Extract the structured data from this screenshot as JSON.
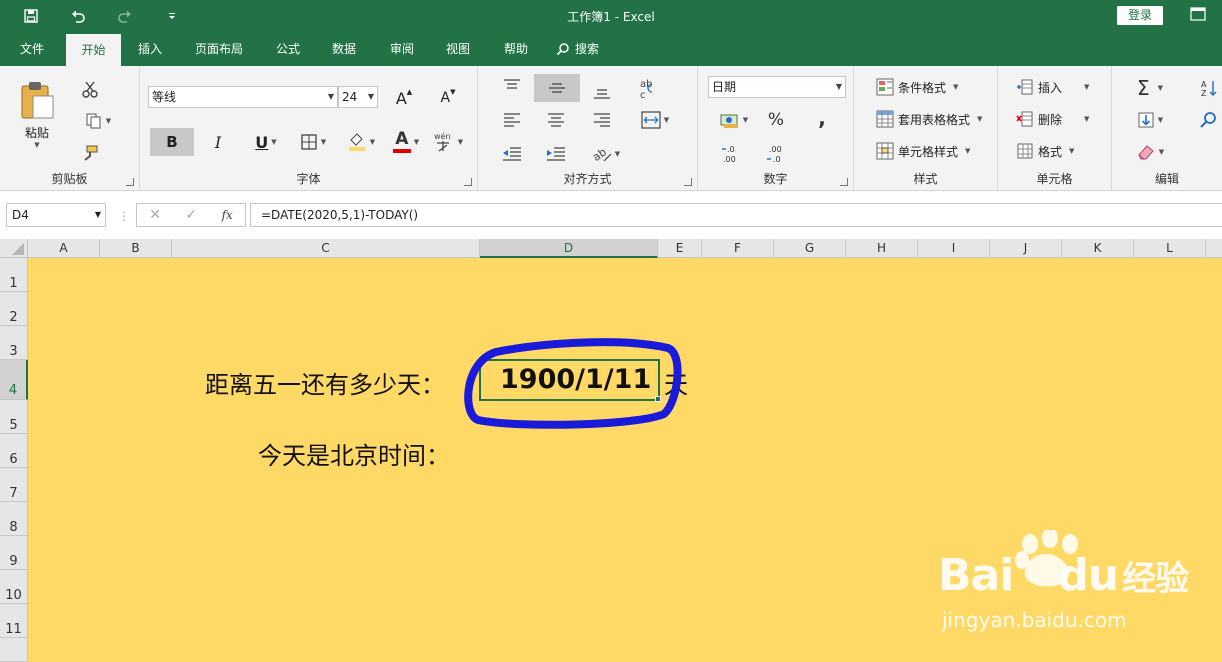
{
  "window": {
    "title": "工作簿1  -  Excel",
    "login": "登录"
  },
  "tabs": [
    {
      "label": "文件"
    },
    {
      "label": "开始"
    },
    {
      "label": "插入"
    },
    {
      "label": "页面布局"
    },
    {
      "label": "公式"
    },
    {
      "label": "数据"
    },
    {
      "label": "审阅"
    },
    {
      "label": "视图"
    },
    {
      "label": "帮助"
    },
    {
      "label": "搜索"
    }
  ],
  "ribbon": {
    "clipboard": {
      "label": "剪贴板",
      "paste": "粘贴"
    },
    "font": {
      "label": "字体",
      "font_name": "等线",
      "font_size": "24",
      "bold": "B",
      "italic": "I",
      "underline": "U",
      "color_letter": "A"
    },
    "alignment": {
      "label": "对齐方式"
    },
    "number": {
      "label": "数字",
      "format": "日期",
      "percent": "%",
      "comma": ","
    },
    "styles": {
      "label": "样式",
      "conditional": "条件格式",
      "table": "套用表格格式",
      "cell_styles": "单元格样式"
    },
    "cells": {
      "label": "单元格",
      "insert": "插入",
      "delete": "删除",
      "format": "格式"
    },
    "editing": {
      "label": "编辑"
    }
  },
  "formula_bar": {
    "name_box": "D4",
    "fx": "fx",
    "formula": "=DATE(2020,5,1)-TODAY()"
  },
  "columns": [
    "A",
    "B",
    "C",
    "D",
    "E",
    "F",
    "G",
    "H",
    "I",
    "J",
    "K",
    "L"
  ],
  "rows": [
    "1",
    "2",
    "3",
    "4",
    "5",
    "6",
    "7",
    "8",
    "9",
    "10",
    "11"
  ],
  "cells": {
    "c4": "距离五一还有多少天：",
    "d4": "1900/1/11",
    "e4": "天",
    "c6": "今天是北京时间："
  },
  "colors": {
    "excel_green": "#217346",
    "sheet_fill": "#ffd966",
    "annotation": "#1a1adb"
  },
  "watermark": {
    "brand": "Bai",
    "brand2": "du",
    "cn": "经验",
    "url": "jingyan.baidu.com"
  }
}
